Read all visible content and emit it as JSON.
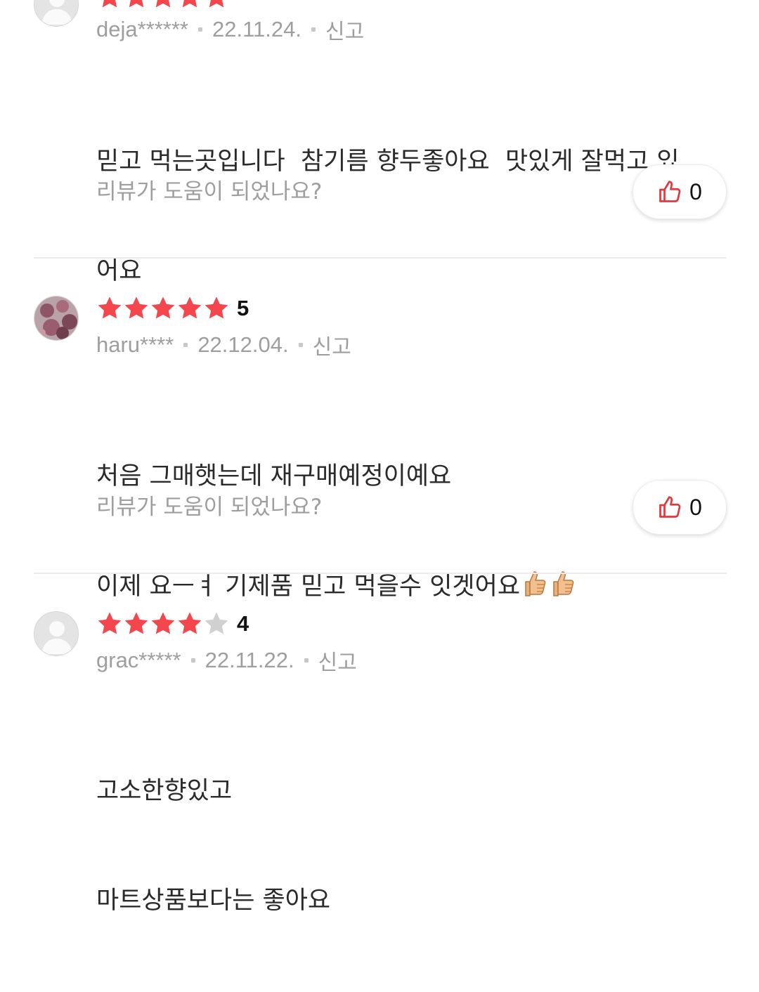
{
  "helpful_question": "리뷰가 도움이 되었나요?",
  "report_label": "신고",
  "colors": {
    "star_filled": "#f3464d",
    "star_empty": "#d0d0d0",
    "thumb_red": "#e0383e"
  },
  "reviews": [
    {
      "rating": 5,
      "user": "deja******",
      "date": "22.11.24.",
      "text_lines": [
        "믿고 먹는곳입니다  참기름 향두좋아요  맛있게 잘먹고 있",
        "어요"
      ],
      "likes": "0"
    },
    {
      "rating": 5,
      "rating_label": "5",
      "user": "haru****",
      "date": "22.12.04.",
      "text_lines": [
        "처음 그매햇는데 재구매예정이예요",
        "이제 요ㅡㅕ 기제품 믿고 먹을수 잇겟어요"
      ],
      "likes": "0"
    },
    {
      "rating": 4,
      "rating_label": "4",
      "user": "grac*****",
      "date": "22.11.22.",
      "text_lines": [
        "고소한향있고",
        "마트상품보다는 좋아요"
      ],
      "likes": ""
    }
  ]
}
